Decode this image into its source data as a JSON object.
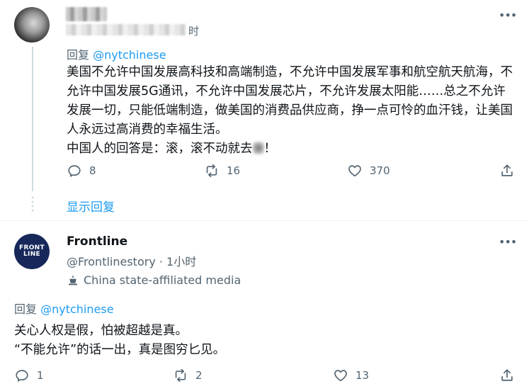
{
  "tweet1": {
    "time": "时",
    "reply_label": "回复",
    "reply_mention": "@nytchinese",
    "text": "美国不允许中国发展高科技和高端制造，不允许中国发展军事和航空航天航海，不允许中国发展5G通讯，不允许中国发展芯片，不允许发展太阳能……总之不允许发展一切，只能低端制造，做美国的消费品供应商，挣一点可怜的血汗钱，让美国人永远过高消费的幸福生活。",
    "text_line2_pre": "中国人的回答是：滚，滚不动就去",
    "text_line2_post": "！",
    "replies": "8",
    "retweets": "16",
    "likes": "370",
    "show_replies": "显示回复"
  },
  "tweet2": {
    "avatar_text_top": "FRONT",
    "avatar_text_bottom": "LINE",
    "name": "Frontline",
    "handle": "@Frontlinestory · 1小时",
    "media_label": "China state-affiliated media",
    "reply_label": "回复",
    "reply_mention": "@nytchinese",
    "text_line1": "关心人权是假，怕被超越是真。",
    "text_line2": "“不能允许”的话一出，真是图穷匕见。",
    "replies": "1",
    "retweets": "2",
    "likes": "13"
  },
  "icons": [
    "more-icon",
    "reply-icon",
    "retweet-icon",
    "like-icon",
    "share-icon",
    "state-media-icon"
  ],
  "colors": {
    "accent": "#1d9bf0",
    "secondary_text": "#536471",
    "primary_text": "#0f1419",
    "divider": "#eff3f4",
    "avatar_bg": "#16275a"
  }
}
